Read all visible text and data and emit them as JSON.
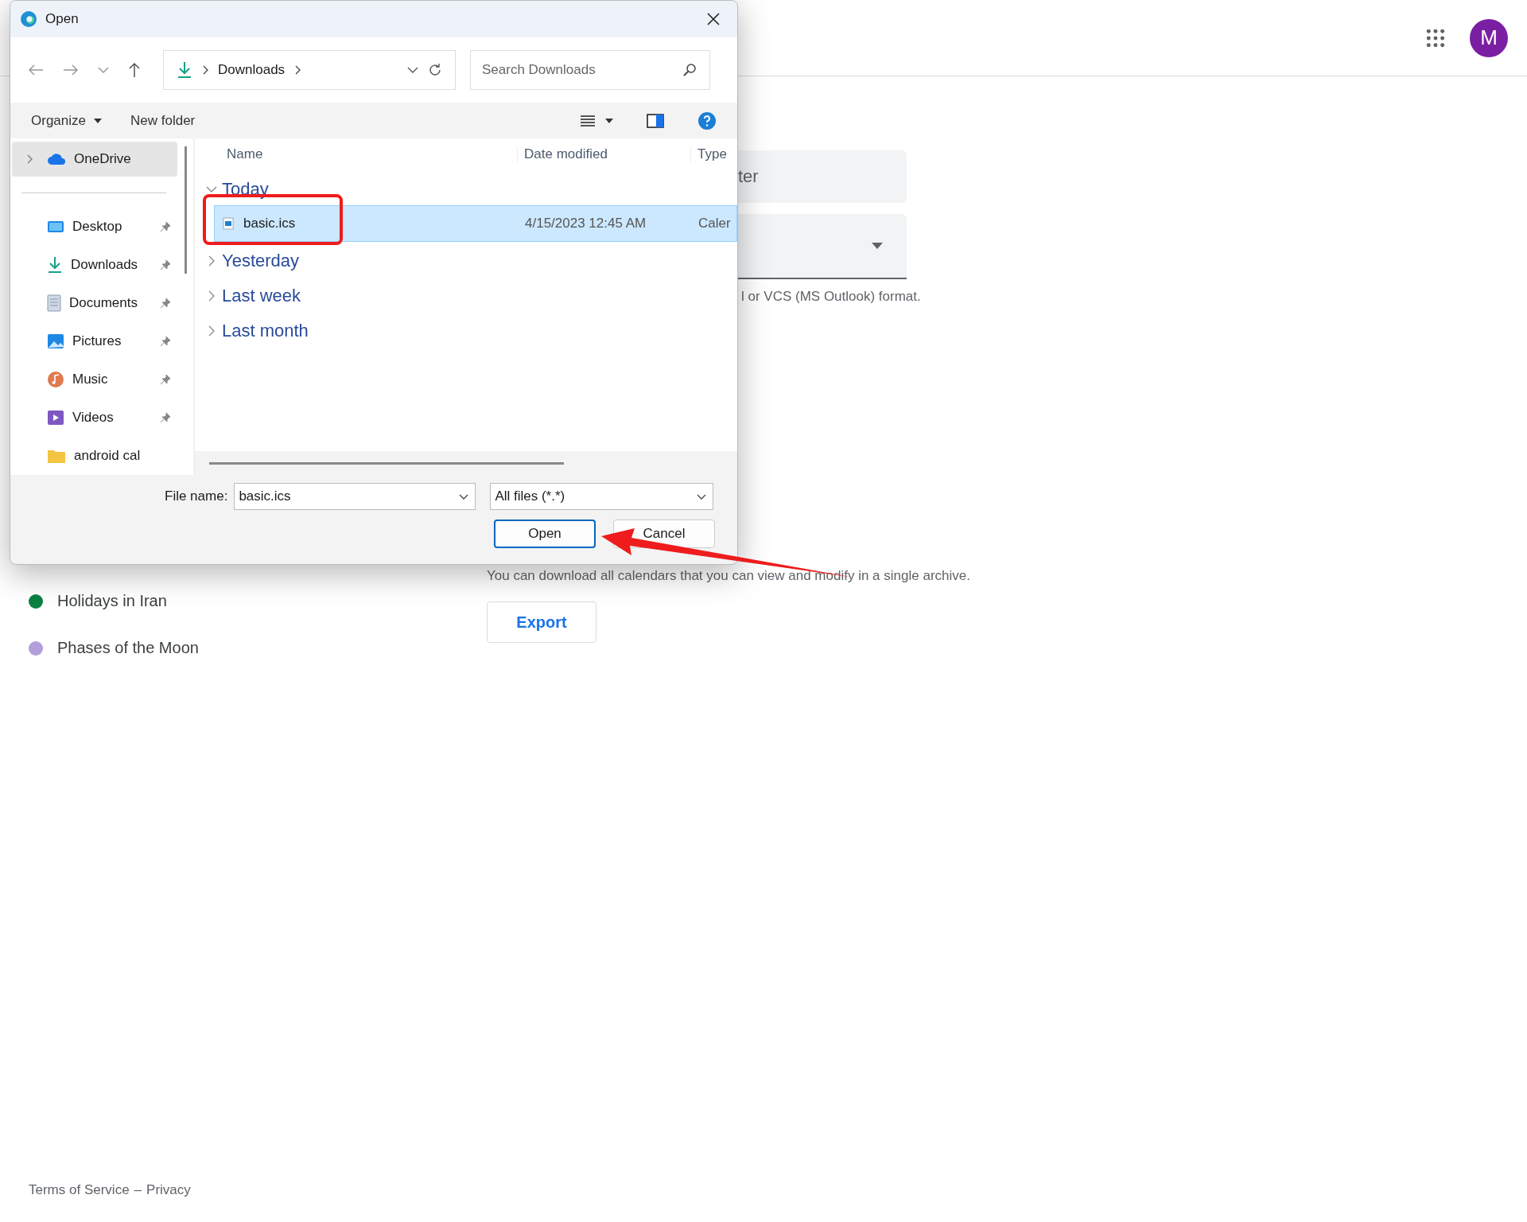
{
  "page": {
    "header": {
      "avatar_letter": "M"
    },
    "import_fields": [
      {
        "kind": "text",
        "value": "ter"
      },
      {
        "kind": "select"
      }
    ],
    "format_note": "l or VCS (MS Outlook) format.",
    "other_calendars": [
      {
        "name": "Holidays in Iran",
        "color": "#0b8043"
      },
      {
        "name": "Phases of the Moon",
        "color": "#b39ddb"
      }
    ],
    "export": {
      "description": "You can download all calendars that you can view and modify in a single archive.",
      "button": "Export"
    },
    "footer": {
      "terms": "Terms of Service",
      "separator": "–",
      "privacy": "Privacy"
    }
  },
  "dialog": {
    "title": "Open",
    "address": {
      "location": "Downloads"
    },
    "search": {
      "placeholder": "Search Downloads"
    },
    "toolbar": {
      "organize": "Organize",
      "new_folder": "New folder"
    },
    "nav": [
      {
        "label": "OneDrive",
        "selected": true,
        "pinned": false,
        "expandable": true
      },
      {
        "label": "Desktop",
        "selected": false,
        "pinned": true,
        "expandable": false
      },
      {
        "label": "Downloads",
        "selected": false,
        "pinned": true,
        "expandable": false
      },
      {
        "label": "Documents",
        "selected": false,
        "pinned": true,
        "expandable": false
      },
      {
        "label": "Pictures",
        "selected": false,
        "pinned": true,
        "expandable": false
      },
      {
        "label": "Music",
        "selected": false,
        "pinned": true,
        "expandable": false
      },
      {
        "label": "Videos",
        "selected": false,
        "pinned": true,
        "expandable": false
      },
      {
        "label": "android cal",
        "selected": false,
        "pinned": false,
        "expandable": false
      }
    ],
    "columns": [
      "Name",
      "Date modified",
      "Type"
    ],
    "groups": [
      {
        "label": "Today",
        "expanded": true,
        "files": [
          {
            "name": "basic.ics",
            "date": "4/15/2023 12:45 AM",
            "type": "Caler",
            "selected": true
          }
        ]
      },
      {
        "label": "Yesterday",
        "expanded": false
      },
      {
        "label": "Last week",
        "expanded": false
      },
      {
        "label": "Last month",
        "expanded": false
      }
    ],
    "file_name": {
      "label": "File name:",
      "value": "basic.ics"
    },
    "filter": "All files (*.*)",
    "buttons": [
      {
        "label": "Open",
        "kind": "primary"
      },
      {
        "label": "Cancel",
        "kind": "secondary"
      }
    ]
  }
}
